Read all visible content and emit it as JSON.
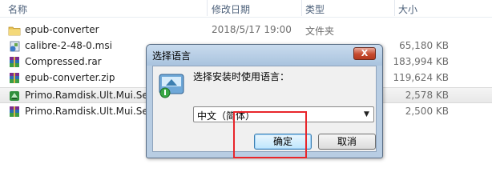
{
  "columns": {
    "name": "名称",
    "date": "修改日期",
    "type": "类型",
    "size": "大小"
  },
  "files": [
    {
      "name": "epub-converter",
      "date": "2018/5/17 19:00",
      "type": "文件夹",
      "size": "",
      "icon": "folder-icon"
    },
    {
      "name": "calibre-2-48-0.msi",
      "date": "",
      "type": "",
      "size": "65,180 KB",
      "icon": "msi-installer-icon"
    },
    {
      "name": "Compressed.rar",
      "date": "",
      "type": "",
      "size": "183,994 KB",
      "icon": "rar-archive-icon"
    },
    {
      "name": "epub-converter.zip",
      "date": "",
      "type": "",
      "size": "119,624 KB",
      "icon": "zip-archive-icon"
    },
    {
      "name": "Primo.Ramdisk.Ult.Mui.Setu",
      "date": "",
      "type": "",
      "size": "2,578 KB",
      "icon": "setup-exe-icon"
    },
    {
      "name": "Primo.Ramdisk.Ult.Mui.Setu",
      "date": "",
      "type": "",
      "size": "2,500 KB",
      "icon": "rar-archive-icon"
    }
  ],
  "dialog": {
    "title": "选择语言",
    "close_label": "X",
    "prompt": "选择安装时使用语言：",
    "selected_language": "中文（简体）",
    "ok_label": "确定",
    "cancel_label": "取消"
  },
  "colors": {
    "highlight": "#e8262b",
    "dialog_frame": "#b8cde3",
    "close_button": "#c64a2e"
  }
}
